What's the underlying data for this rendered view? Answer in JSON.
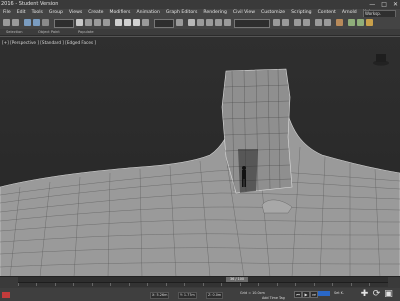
{
  "app": {
    "title_fragment": "2016 - Student Version",
    "win_min": "—",
    "win_max": "□",
    "win_close": "✕"
  },
  "menu": [
    "File",
    "Edit",
    "Tools",
    "Group",
    "Views",
    "Create",
    "Modifiers",
    "Animation",
    "Graph Editors",
    "Rendering",
    "Civil View",
    "Customize",
    "Scripting",
    "Content",
    "Arnold",
    "Help"
  ],
  "workspace_label": "Worksp.",
  "toolbar_labels": {
    "undo": "Undo",
    "redo": "Redo",
    "select_filter": "All",
    "view_dropdown": "View",
    "create_selection_set": "Create Selection Se"
  },
  "sub_labels": {
    "selection": "Selection",
    "object_paint": "Object Paint",
    "populate": "Populate"
  },
  "viewport": {
    "label": "[+] [Perspective ] [Standard ] [Edged Faces ]"
  },
  "timeline": {
    "position": "36 / 100",
    "position_fraction": 0.36
  },
  "status": {
    "coord_x": "X: 5.26m",
    "coord_y": "Y: 1.77m",
    "coord_z": "Z: 0.0m",
    "grid": "Grid = 10.0cm",
    "add_time_tag": "Add Time Tag",
    "autokey": "Auto",
    "setkey": "Set K."
  },
  "colors": {
    "accent_blue": "#2a68c8",
    "red": "#c23b3b",
    "wire": "#c9c9c9"
  }
}
